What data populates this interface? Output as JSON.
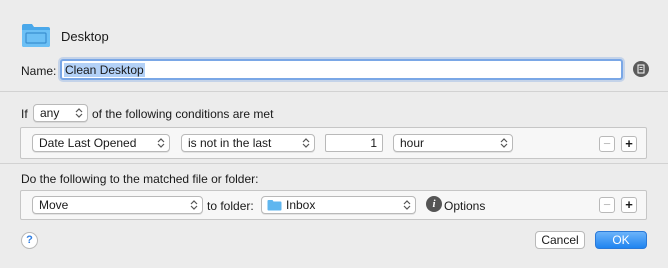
{
  "header": {
    "title": "Desktop",
    "icon": "folder-icon"
  },
  "name": {
    "label": "Name:",
    "value": "Clean Desktop"
  },
  "conditions": {
    "if_label": "If",
    "match_value": "any",
    "following_text": "of the following conditions are met",
    "rule": {
      "attribute": "Date Last Opened",
      "operator": "is not in the last",
      "amount": "1",
      "unit": "hour"
    }
  },
  "actions": {
    "label": "Do the following to the matched file or folder:",
    "action": "Move",
    "to_folder_label": "to folder:",
    "folder": "Inbox",
    "options_label": "Options"
  },
  "buttons": {
    "remove": "−",
    "add": "+",
    "help": "?",
    "cancel": "Cancel",
    "ok": "OK"
  },
  "colors": {
    "accent": "#1f84f0",
    "folder_blue": "#5fb6ef"
  }
}
